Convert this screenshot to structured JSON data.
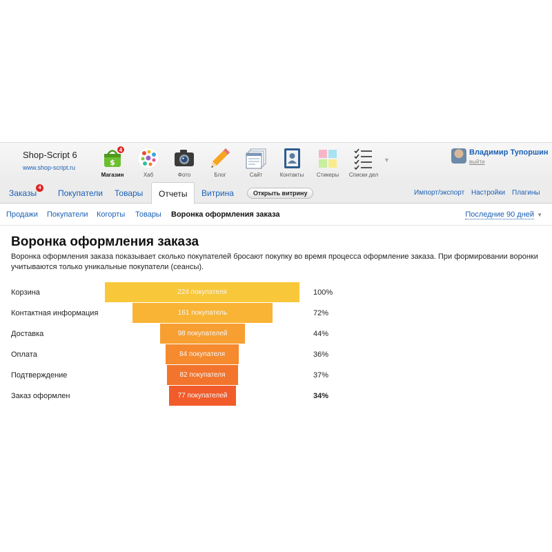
{
  "brand": {
    "title": "Shop-Script 6",
    "url": "www.shop-script.ru"
  },
  "apps": [
    {
      "name": "store",
      "label": "Магазин",
      "icon": "shopping-basket-icon",
      "active": true,
      "badge": "4"
    },
    {
      "name": "hub",
      "label": "Хаб",
      "icon": "bubbles-icon",
      "active": false,
      "badge": ""
    },
    {
      "name": "photos",
      "label": "Фото",
      "icon": "camera-icon",
      "active": false,
      "badge": ""
    },
    {
      "name": "blog",
      "label": "Блог",
      "icon": "pencil-icon",
      "active": false,
      "badge": ""
    },
    {
      "name": "site",
      "label": "Сайт",
      "icon": "web-pages-icon",
      "active": false,
      "badge": ""
    },
    {
      "name": "contacts",
      "label": "Контакты",
      "icon": "address-book-icon",
      "active": false,
      "badge": ""
    },
    {
      "name": "stickies",
      "label": "Стикеры",
      "icon": "sticky-notes-icon",
      "active": false,
      "badge": ""
    },
    {
      "name": "checklists",
      "label": "Списки дел",
      "icon": "checklist-icon",
      "active": false,
      "badge": ""
    }
  ],
  "apps_more_glyph": "▼",
  "user": {
    "name": "Владимир Тупоршин",
    "logout": "выйти"
  },
  "tabs": {
    "orders": {
      "label": "Заказы",
      "badge": "4"
    },
    "customers": "Покупатели",
    "products": "Товары",
    "reports": "Отчеты",
    "storefront": "Витрина",
    "open_store": "Открыть витрину",
    "import_export": "Импорт/экспорт",
    "settings": "Настройки",
    "plugins": "Плагины"
  },
  "subnav": {
    "sales": "Продажи",
    "customers": "Покупатели",
    "cohorts": "Когорты",
    "products": "Товары",
    "checkout_funnel": "Воронка оформления заказа",
    "period": "Последние 90 дней",
    "period_caret": "▼"
  },
  "report": {
    "title": "Воронка оформления заказа",
    "description": "Воронка оформления заказа показывает сколько покупателей бросают покупку во время процесса оформление заказа. При формировании воронки учитываются только уникальные покупатели (сеансы)."
  },
  "chart_data": {
    "type": "bar",
    "categories": [
      "Корзина",
      "Контактная информация",
      "Доставка",
      "Оплата",
      "Подтверждение",
      "Заказ оформлен"
    ],
    "values": [
      224,
      161,
      98,
      84,
      82,
      77
    ],
    "bar_labels": [
      "224 покупателя",
      "161 покупатель",
      "98 покупателей",
      "84 покупателя",
      "82 покупателя",
      "77 покупателей"
    ],
    "percents": [
      "100%",
      "72%",
      "44%",
      "36%",
      "37%",
      "34%"
    ],
    "colors": [
      "#f9c83a",
      "#f9b435",
      "#f79f31",
      "#f58a2e",
      "#f3742c",
      "#f15c2a"
    ]
  }
}
